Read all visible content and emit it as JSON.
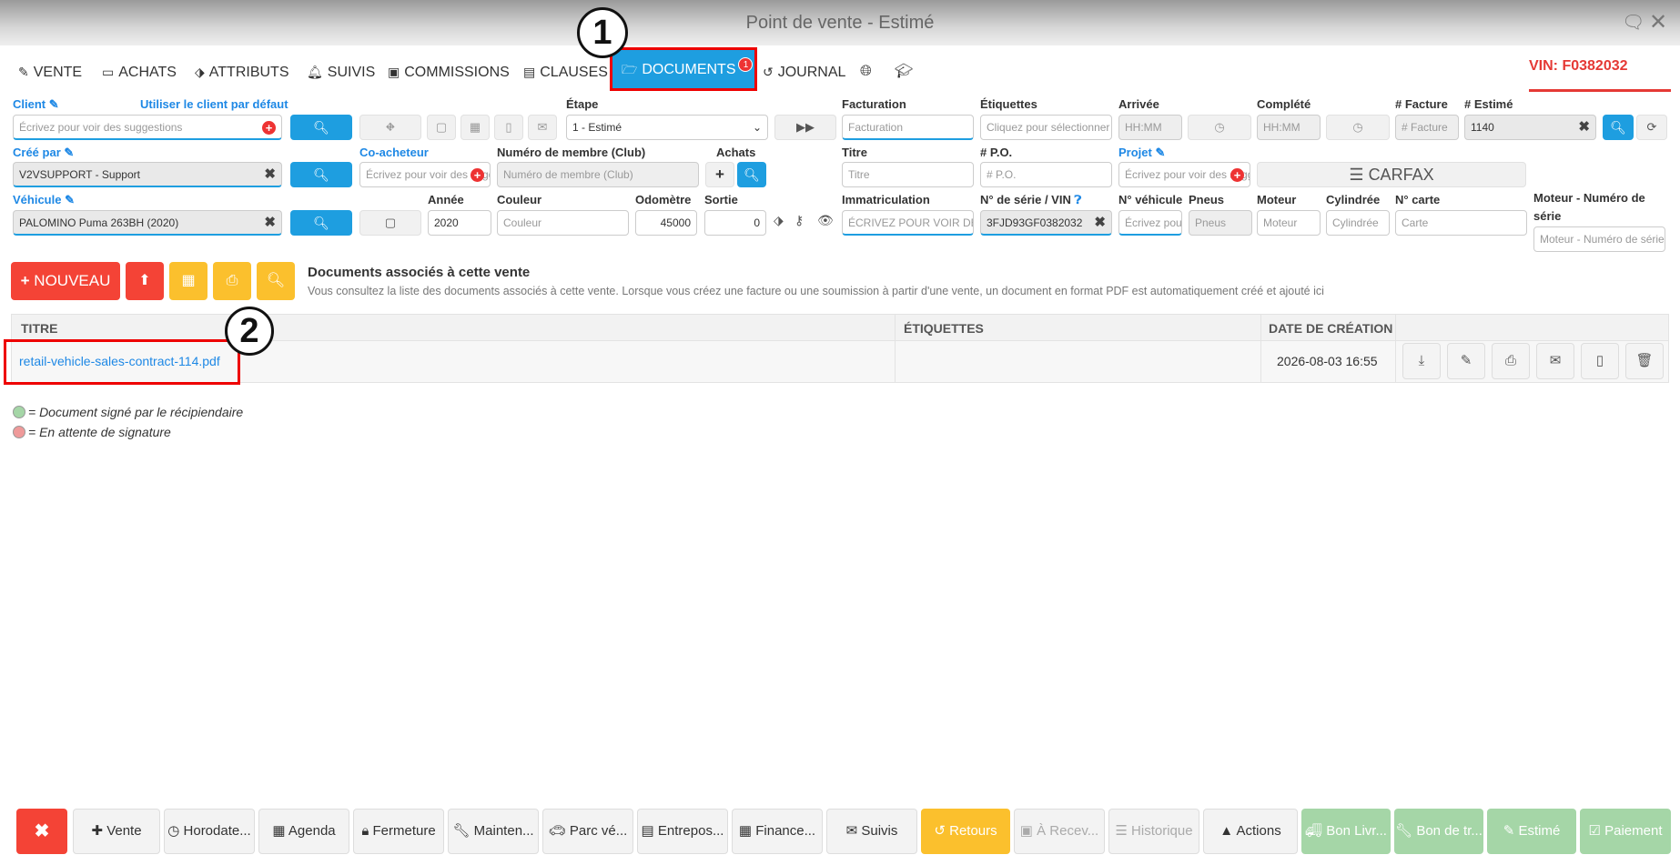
{
  "window": {
    "title": "Point de vente - Estimé"
  },
  "tabs": [
    {
      "label": "VENTE",
      "icon": "edit-icon"
    },
    {
      "label": "ACHATS",
      "icon": "card-icon"
    },
    {
      "label": "ATTRIBUTS",
      "icon": "tags-icon"
    },
    {
      "label": "SUIVIS",
      "icon": "bell-icon"
    },
    {
      "label": "COMMISSIONS",
      "icon": "money-icon"
    },
    {
      "label": "CLAUSES",
      "icon": "file-icon"
    },
    {
      "label": "DOCUMENTS",
      "icon": "folder-open-icon",
      "badge": "1",
      "active": true
    },
    {
      "label": "JOURNAL",
      "icon": "history-icon"
    }
  ],
  "vin_tab": {
    "label": "VIN: F0382032"
  },
  "form": {
    "client_label": "Client",
    "client_default_link": "Utiliser le client par défaut",
    "client_placeholder": "Écrivez pour voir des suggestions",
    "etape_label": "Étape",
    "etape_value": "1 - Estimé",
    "facturation_label": "Facturation",
    "facturation_placeholder": "Facturation",
    "etiquettes_label": "Étiquettes",
    "etiquettes_placeholder": "Cliquez pour sélectionner",
    "arrivee_label": "Arrivée",
    "arrivee_placeholder": "HH:MM",
    "complete_label": "Complété",
    "complete_placeholder": "HH:MM",
    "facture_label": "# Facture",
    "facture_placeholder": "# Facture",
    "estime_label": "# Estimé",
    "estime_value": "1140",
    "cree_par_label": "Créé par",
    "cree_par_value": "V2VSUPPORT - Support",
    "coacheteur_label": "Co-acheteur",
    "coacheteur_placeholder": "Écrivez pour voir des sugg",
    "membre_label": "Numéro de membre (Club)",
    "membre_placeholder": "Numéro de membre (Club)",
    "achats_label": "Achats",
    "titre_label": "Titre",
    "titre_placeholder": "Titre",
    "po_label": "# P.O.",
    "po_placeholder": "# P.O.",
    "projet_label": "Projet",
    "projet_placeholder": "Écrivez pour voir des sugg",
    "carfax_label": "CARFAX",
    "vehicule_label": "Véhicule",
    "vehicule_value": "PALOMINO Puma 263BH (2020)",
    "annee_label": "Année",
    "annee_value": "2020",
    "couleur_label": "Couleur",
    "couleur_placeholder": "Couleur",
    "odometre_label": "Odomètre",
    "odometre_value": "45000",
    "sortie_label": "Sortie",
    "sortie_value": "0",
    "immat_label": "Immatriculation",
    "immat_placeholder": "ÉCRIVEZ POUR VOIR DES SUGG",
    "serie_label": "N° de série / VIN",
    "serie_value": "3FJD93GF0382032",
    "noveh_label": "N° véhicule",
    "noveh_placeholder": "Écrivez pour",
    "pneus_label": "Pneus",
    "pneus_placeholder": "Pneus",
    "moteur_label": "Moteur",
    "moteur_placeholder": "Moteur",
    "cylindree_label": "Cylindrée",
    "cylindree_placeholder": "Cylindrée",
    "carte_label": "N° carte",
    "carte_placeholder": "Carte",
    "moteur_serie_label": "Moteur - Numéro de série",
    "moteur_serie_placeholder": "Moteur - Numéro de série"
  },
  "documents": {
    "new_button": "NOUVEAU",
    "heading": "Documents associés à cette vente",
    "description": "Vous consultez la liste des documents associés à cette vente. Lorsque vous créez une facture ou une soumission à partir d'une vente, un document en format PDF est automatiquement créé et ajouté ici",
    "columns": [
      "TITRE",
      "ÉTIQUETTES",
      "DATE DE CRÉATION"
    ],
    "rows": [
      {
        "title": "retail-vehicle-sales-contract-114.pdf",
        "tags": "",
        "date": "2026-08-03 16:55"
      }
    ],
    "legend_signed": "= Document signé par le récipiendaire",
    "legend_pending": "= En attente de signature"
  },
  "annotations": {
    "step1": "1",
    "step2": "2"
  },
  "bottom_bar": [
    {
      "label": "✖",
      "style": "redb"
    },
    {
      "label": "Vente",
      "icon": "plus-icon"
    },
    {
      "label": "Horodate...",
      "icon": "clock-icon"
    },
    {
      "label": "Agenda",
      "icon": "calendar-icon"
    },
    {
      "label": "Fermeture",
      "icon": "lock-icon"
    },
    {
      "label": "Mainten...",
      "icon": "wrench-icon"
    },
    {
      "label": "Parc vé...",
      "icon": "car-icon"
    },
    {
      "label": "Entrepos...",
      "icon": "archive-icon"
    },
    {
      "label": "Finance...",
      "icon": "table-icon"
    },
    {
      "label": "Suivis",
      "icon": "envelope-icon"
    },
    {
      "label": "Retours",
      "icon": "undo-icon",
      "style": "orange"
    },
    {
      "label": "À Recev...",
      "icon": "money-icon",
      "style": "disabled"
    },
    {
      "label": "Historique",
      "icon": "list-icon",
      "style": "disabled"
    },
    {
      "label": "Actions",
      "icon": "caret-up-icon"
    },
    {
      "label": "Bon Livr...",
      "icon": "truck-icon",
      "style": "green"
    },
    {
      "label": "Bon de tr...",
      "icon": "wrench-icon",
      "style": "green"
    },
    {
      "label": "Estimé",
      "icon": "edit-icon",
      "style": "green"
    },
    {
      "label": "Paiement",
      "icon": "check-icon",
      "style": "green"
    }
  ],
  "colors": {
    "accent": "#1e9ee0",
    "danger": "#f44336",
    "warning": "#fbc02d",
    "success": "#a5d6a7"
  }
}
